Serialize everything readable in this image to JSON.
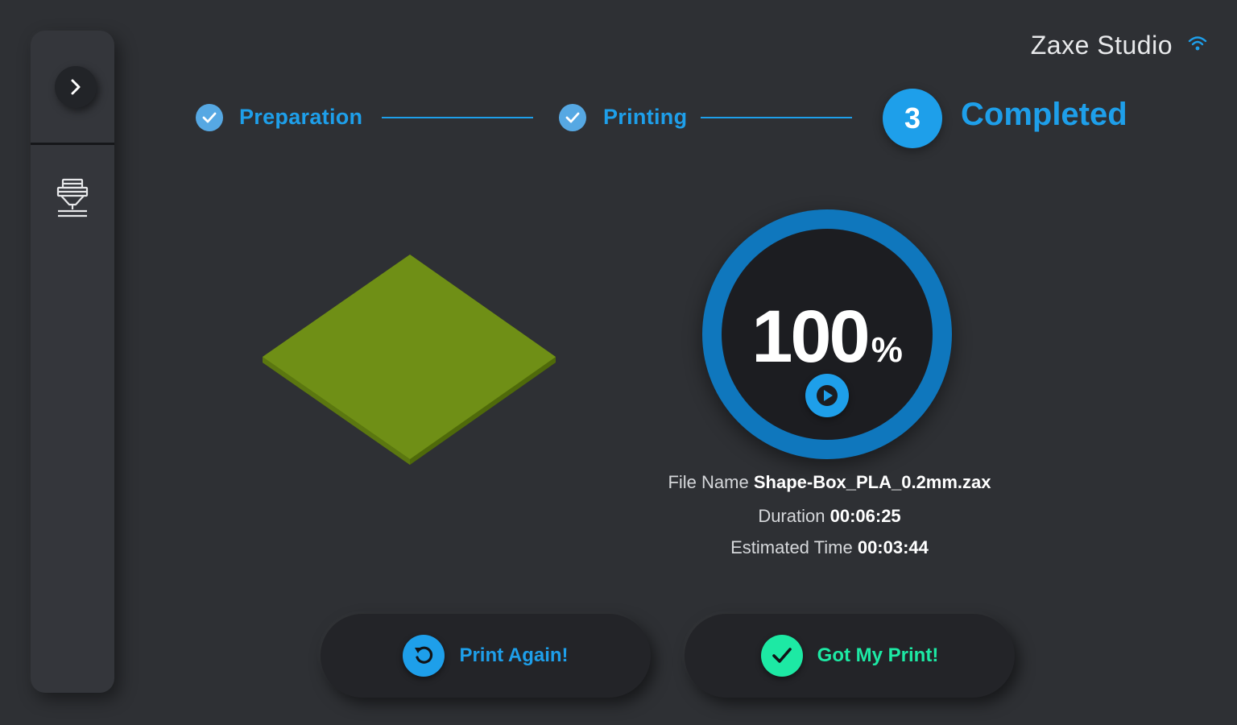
{
  "header": {
    "brand": "Zaxe Studio",
    "wifi_icon": "wifi-icon"
  },
  "sidebar": {
    "toggle_icon": "chevron-right-icon",
    "items": [
      {
        "icon": "printer-icon"
      }
    ]
  },
  "steps": [
    {
      "label": "Preparation",
      "status": "done"
    },
    {
      "label": "Printing",
      "status": "done"
    },
    {
      "number": "3",
      "label": "Completed",
      "status": "active"
    }
  ],
  "progress": {
    "value": "100",
    "unit": "%",
    "fraction": 1.0
  },
  "file_info": {
    "file_name_label": "File Name",
    "file_name": "Shape-Box_PLA_0.2mm.zax",
    "duration_label": "Duration",
    "duration": "00:06:25",
    "estimated_label": "Estimated Time",
    "estimated": "00:03:44"
  },
  "actions": {
    "print_again": "Print Again!",
    "got_print": "Got My Print!"
  },
  "colors": {
    "accent": "#1e9fea",
    "success": "#1de9a4",
    "model": "#6f8f16",
    "background": "#2e3034"
  }
}
